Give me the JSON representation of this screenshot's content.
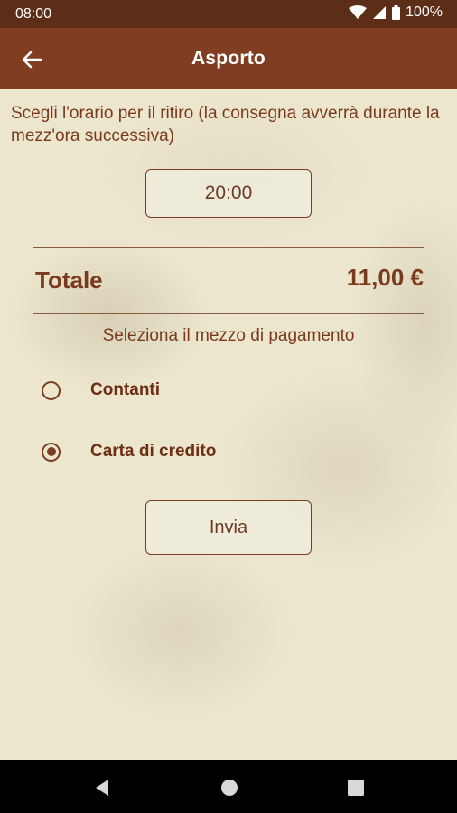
{
  "status_bar": {
    "time": "08:00",
    "battery": "100%"
  },
  "app_bar": {
    "title": "Asporto"
  },
  "pickup": {
    "instruction": "Scegli l'orario per il ritiro (la consegna avverrà durante la mezz'ora successiva)",
    "time": "20:00"
  },
  "total": {
    "label": "Totale",
    "value": "11,00 €"
  },
  "payment": {
    "label": "Seleziona il mezzo di pagamento",
    "options": [
      {
        "label": "Contanti",
        "selected": false
      },
      {
        "label": "Carta di credito",
        "selected": true
      }
    ]
  },
  "submit": {
    "label": "Invia"
  },
  "colors": {
    "app_bar": "#813d21",
    "status_bar": "#5d2e17",
    "accent": "#7b3c20",
    "text": "#7a3a1c"
  }
}
